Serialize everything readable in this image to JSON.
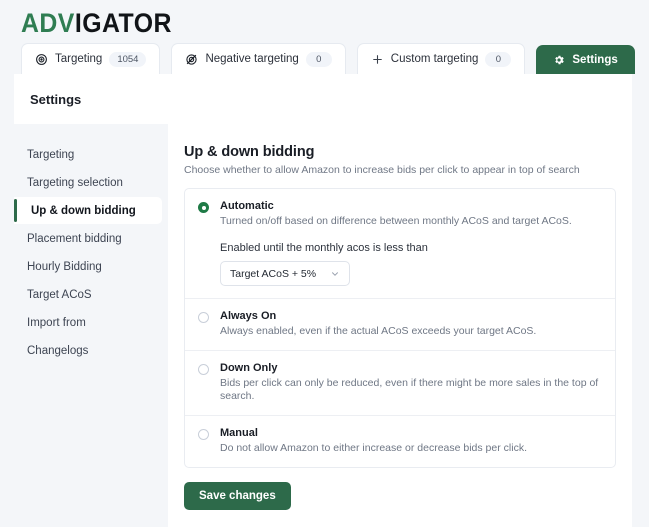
{
  "brand": {
    "name_green": "ADV",
    "name_dark": "IGATOR"
  },
  "tabs": [
    {
      "label": "Targeting",
      "badge": "1054",
      "icon": "target-icon",
      "active": false
    },
    {
      "label": "Negative targeting",
      "badge": "0",
      "icon": "target-slash-icon",
      "active": false
    },
    {
      "label": "Custom targeting",
      "badge": "0",
      "icon": "plus-icon",
      "active": false
    },
    {
      "label": "Settings",
      "badge": "",
      "icon": "gear-icon",
      "active": true
    }
  ],
  "header": {
    "title": "Settings"
  },
  "sidebar": {
    "items": [
      {
        "label": "Targeting",
        "active": false
      },
      {
        "label": "Targeting selection",
        "active": false
      },
      {
        "label": "Up & down bidding",
        "active": true
      },
      {
        "label": "Placement bidding",
        "active": false
      },
      {
        "label": "Hourly Bidding",
        "active": false
      },
      {
        "label": "Target ACoS",
        "active": false
      },
      {
        "label": "Import from",
        "active": false
      },
      {
        "label": "Changelogs",
        "active": false
      }
    ]
  },
  "content": {
    "title": "Up & down bidding",
    "subtitle": "Choose whether to allow Amazon to increase bids per click to appear in top of search",
    "options": [
      {
        "title": "Automatic",
        "desc": "Turned on/off based on difference between monthly ACoS and target ACoS.",
        "selected": true,
        "sub_label": "Enabled until the monthly acos is less than",
        "sub_value": "Target ACoS + 5%"
      },
      {
        "title": "Always On",
        "desc": "Always enabled, even if the actual ACoS exceeds your target ACoS.",
        "selected": false
      },
      {
        "title": "Down Only",
        "desc": "Bids per click can only be reduced, even if there might be more sales in the top of search.",
        "selected": false
      },
      {
        "title": "Manual",
        "desc": "Do not allow Amazon to either increase or decrease bids per click.",
        "selected": false
      }
    ],
    "save_label": "Save changes"
  },
  "colors": {
    "brand_green": "#2d6a4a",
    "accent_green": "#1f7a46",
    "page_bg": "#f4f6f9",
    "panel_bg": "#ffffff"
  }
}
